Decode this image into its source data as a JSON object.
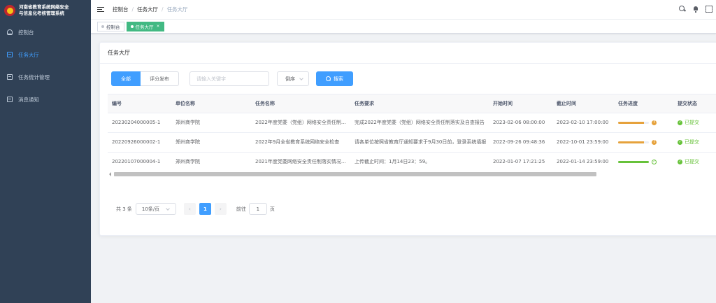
{
  "sidebar": {
    "title_line1": "河南省教育系统网络安全",
    "title_line2": "与信息化考核管理系统",
    "items": [
      {
        "label": "控制台"
      },
      {
        "label": "任务大厅"
      },
      {
        "label": "任务统计管理"
      },
      {
        "label": "消息通知"
      }
    ]
  },
  "navbar": {
    "breadcrumb": [
      "控制台",
      "任务大厅",
      "任务大厅"
    ],
    "separator": "/"
  },
  "tags": [
    {
      "label": "控制台"
    },
    {
      "label": "任务大厅",
      "close": "×"
    }
  ],
  "card": {
    "title": "任务大厅",
    "filters": {
      "all": "全部",
      "review": "评分发布"
    },
    "keyword_placeholder": "请输入关键字",
    "sort_label": "倒序",
    "search_label": "搜索"
  },
  "table": {
    "columns": [
      "编号",
      "单位名称",
      "任务名称",
      "任务要求",
      "开始时间",
      "截止时间",
      "任务进度",
      "提交状态"
    ],
    "rows": [
      {
        "id": "20230204000005-1",
        "unit": "郑州商学院",
        "name": "2022年度党委（党组）网络安全责任制落实情况报告",
        "req": "完成2022年度党委（党组）网络安全责任制落实及自查报告",
        "start": "2023-02-06 08:00:00",
        "end": "2023-02-10 17:00:00",
        "progress": 0.85,
        "progress_color": "#e6a23c",
        "status": "已提交"
      },
      {
        "id": "20220926000002-1",
        "unit": "郑州商学院",
        "name": "2022年9月全省教育系统网络安全检查",
        "req": "请各单位按照省教育厅通知要求于9月30日前，登录系统填报",
        "start": "2022-09-26 09:48:36",
        "end": "2022-10-01 23:59:00",
        "progress": 0.85,
        "progress_color": "#e6a23c",
        "status": "已提交"
      },
      {
        "id": "20220107000004-1",
        "unit": "郑州商学院",
        "name": "2021年度党委网络安全责任制落实情况报告",
        "req": "上传截止时间：1月14日23：59。",
        "start": "2022-01-07 17:21:25",
        "end": "2022-01-14 23:59:00",
        "progress": 1,
        "progress_color": "#67c23a",
        "status": "已提交"
      }
    ]
  },
  "pagination": {
    "total_text": "共 3 条",
    "page_size": "10条/页",
    "current": "1",
    "goto_label": "前往",
    "goto_value": "1",
    "page_unit": "页"
  },
  "colors": {
    "sidebar_bg": "#304156",
    "primary": "#409eff",
    "tag_active": "#42b983",
    "success": "#67c23a",
    "warning": "#e6a23c"
  },
  "icons": {
    "progress_warn": "!",
    "progress_ok": "✓",
    "status_ok": "✓",
    "prev": "‹",
    "next": "›"
  }
}
